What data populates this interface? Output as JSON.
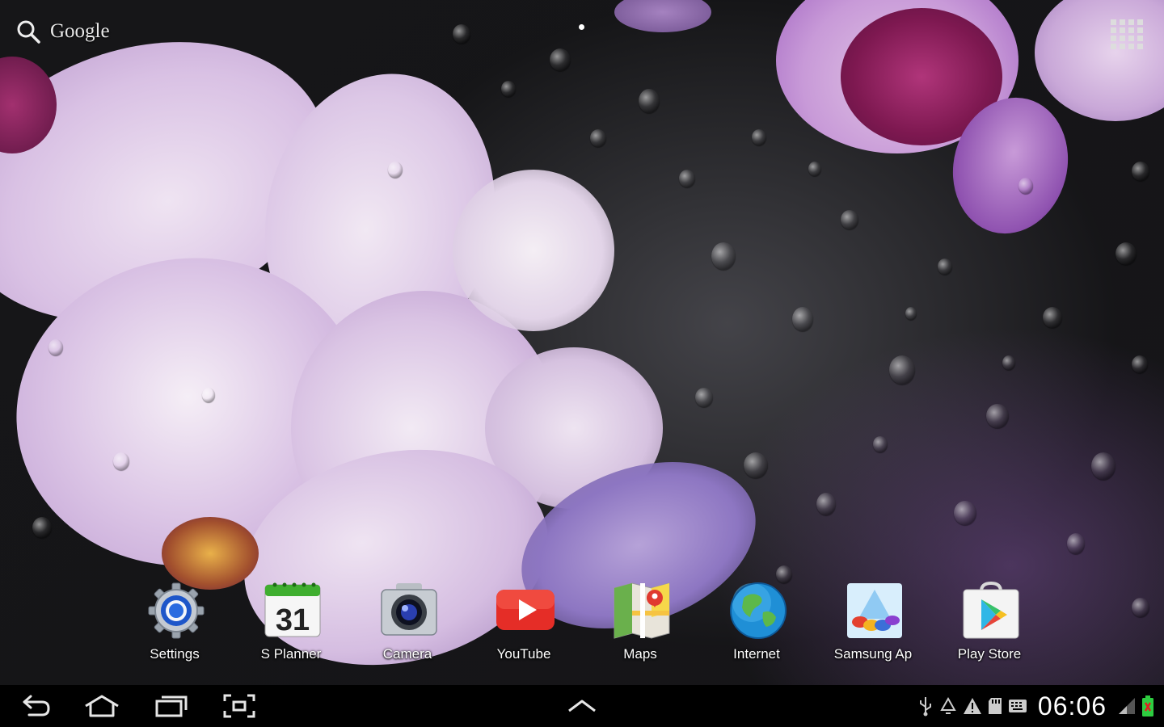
{
  "search": {
    "label": "Google"
  },
  "colors": {
    "accent_purple": "#b78ad0",
    "navbar": "#000000",
    "battery": "#2ecc40"
  },
  "dock": {
    "items": [
      {
        "label": "Settings",
        "icon": "settings-icon"
      },
      {
        "label": "S Planner",
        "icon": "calendar-icon",
        "date": "31"
      },
      {
        "label": "Camera",
        "icon": "camera-icon"
      },
      {
        "label": "YouTube",
        "icon": "youtube-icon"
      },
      {
        "label": "Maps",
        "icon": "maps-icon"
      },
      {
        "label": "Internet",
        "icon": "globe-icon"
      },
      {
        "label": "Samsung Ap",
        "icon": "samsung-apps-icon"
      },
      {
        "label": "Play Store",
        "icon": "play-store-icon"
      }
    ]
  },
  "status_bar": {
    "time": "06:06"
  }
}
